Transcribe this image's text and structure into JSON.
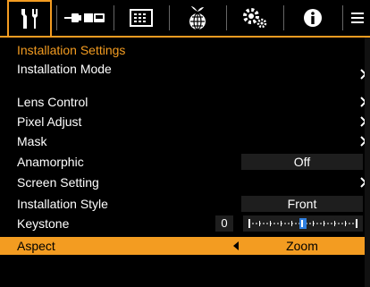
{
  "tabs": [
    {
      "name": "tab-installation",
      "icon": "installation-icon",
      "active": true
    },
    {
      "name": "tab-input-signal",
      "icon": "input-signal-icon",
      "active": false
    },
    {
      "name": "tab-display-setting",
      "icon": "display-setting-icon",
      "active": false
    },
    {
      "name": "tab-eco",
      "icon": "eco-icon",
      "active": false
    },
    {
      "name": "tab-function",
      "icon": "function-icon",
      "active": false
    },
    {
      "name": "tab-information",
      "icon": "information-icon",
      "active": false
    },
    {
      "name": "tab-more",
      "icon": "menu-icon",
      "active": false
    }
  ],
  "section_title": "Installation Settings",
  "menu": {
    "installation_mode": "Installation Mode",
    "lens_control": "Lens Control",
    "pixel_adjust": "Pixel Adjust",
    "mask": "Mask",
    "anamorphic": {
      "label": "Anamorphic",
      "value": "Off"
    },
    "screen_setting": "Screen Setting",
    "installation_style": {
      "label": "Installation Style",
      "value": "Front"
    },
    "keystone": {
      "label": "Keystone",
      "value": "0",
      "level": 0.5
    },
    "aspect": {
      "label": "Aspect",
      "value": "Zoom"
    }
  },
  "colors": {
    "accent": "#f39c21",
    "background": "#000000",
    "value_bg": "#1e1e1e"
  }
}
